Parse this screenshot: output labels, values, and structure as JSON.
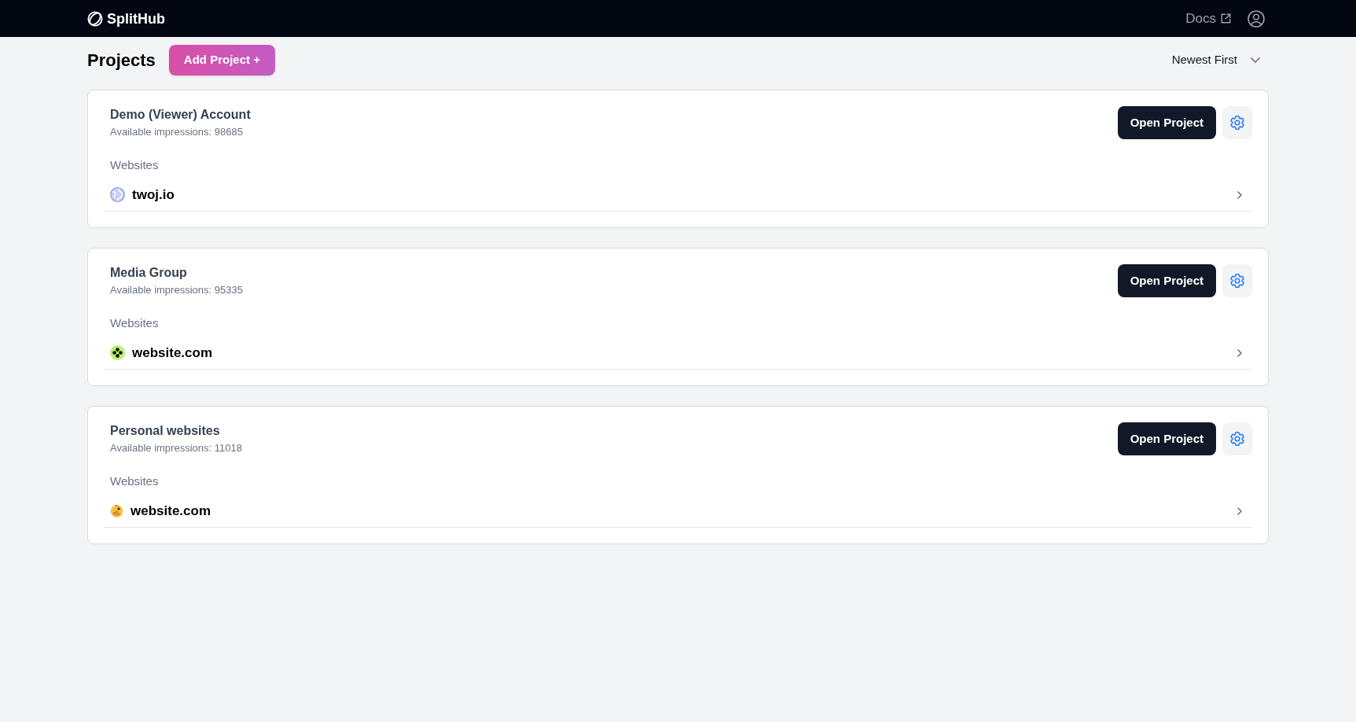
{
  "header": {
    "logo": "SplitHub",
    "docs_link": "Docs"
  },
  "toolbar": {
    "title": "Projects",
    "add_button": "Add Project +",
    "sort": "Newest First"
  },
  "projects": [
    {
      "name": "Demo (Viewer) Account",
      "impressions": "Available impressions: 98685",
      "websites_label": "Websites",
      "open_button": "Open Project",
      "websites": [
        {
          "name": "twoj.io",
          "kind": "globe"
        }
      ]
    },
    {
      "name": "Media Group",
      "impressions": "Available impressions: 95335",
      "websites_label": "Websites",
      "open_button": "Open Project",
      "websites": [
        {
          "name": "website.com",
          "kind": "clover"
        }
      ]
    },
    {
      "name": "Personal websites",
      "impressions": "Available impressions: 11018",
      "websites_label": "Websites",
      "open_button": "Open Project",
      "websites": [
        {
          "name": "website.com",
          "kind": "mascot"
        }
      ]
    }
  ]
}
